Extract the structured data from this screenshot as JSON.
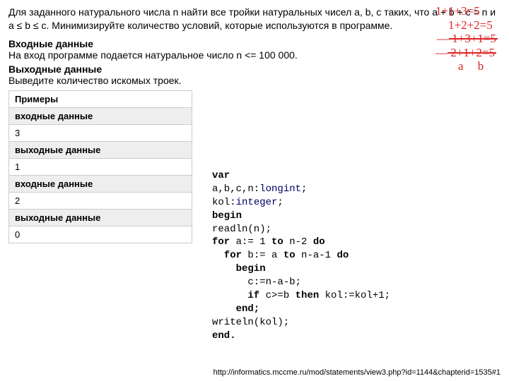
{
  "problem": {
    "para1": "Для заданного натурального числа n найти все тройки натуральных чисел a, b, c таких, что a + b + c = n и a ≤ b ≤ c. Минимизируйте количество условий, которые используются в программе.",
    "input_title": "Входные данные",
    "input_text": "На вход программе подается натуральное число n <= 100 000.",
    "output_title": "Выходные данные",
    "output_text": "Выведите количество искомых троек."
  },
  "examples": {
    "caption": "Примеры",
    "rows": [
      {
        "header": "входные данные",
        "value": "3"
      },
      {
        "header": "выходные данные",
        "value": "1"
      },
      {
        "header": "входные данные",
        "value": "2"
      },
      {
        "header": "выходные данные",
        "value": "0"
      }
    ]
  },
  "code": {
    "l1a": "var",
    "l2a": "a,b,c,n:",
    "l2b": "longint",
    "l2c": ";",
    "l3a": "kol:",
    "l3b": "integer",
    "l3c": ";",
    "l4": "begin",
    "l5": "readln(n);",
    "l6a": "for",
    "l6b": " a:= 1 ",
    "l6c": "to",
    "l6d": " n-2 ",
    "l6e": "do",
    "l7a": "  for",
    "l7b": " b:= a ",
    "l7c": "to",
    "l7d": " n-a-1 ",
    "l7e": "do",
    "l8": "    begin",
    "l9": "      c:=n-a-b;",
    "l10a": "      if",
    "l10b": " c>=b ",
    "l10c": "then",
    "l10d": " kol:=kol+1;",
    "l11": "    end;",
    "l12": "writeln(kol);",
    "l13": "end."
  },
  "annotation": {
    "l1": "1+1+3=5",
    "l2": "1+2+2=5",
    "l3": "1+3+1=5",
    "l4": "2+1+2=5",
    "l5": "a b"
  },
  "url": "http://informatics.mccme.ru/mod/statements/view3.php?id=1144&chapterid=1535#1"
}
